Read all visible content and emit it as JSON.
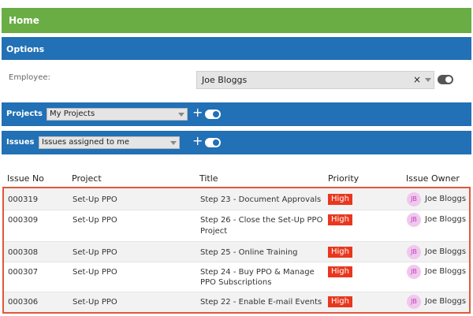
{
  "home": {
    "title": "Home"
  },
  "options": {
    "title": "Options",
    "employee_label": "Employee:",
    "employee_value": "Joe Bloggs",
    "clear_glyph": "×"
  },
  "projects": {
    "label": "Projects",
    "selected": "My Projects",
    "plus": "+"
  },
  "issues": {
    "label": "Issues",
    "selected": "Issues assigned to me",
    "plus": "+"
  },
  "table": {
    "columns": [
      "Issue No",
      "Project",
      "Title",
      "Priority",
      "Issue Owner"
    ],
    "rows": [
      {
        "issue_no": "000319",
        "project": "Set-Up PPO",
        "title_lines": [
          "Step 23 - Document Approvals"
        ],
        "priority": "High",
        "initials": "JB",
        "owner": "Joe Bloggs"
      },
      {
        "issue_no": "000309",
        "project": "Set-Up PPO",
        "title_lines": [
          "Step 26 - Close the Set-Up PPO",
          "Project"
        ],
        "priority": "High",
        "initials": "JB",
        "owner": "Joe Bloggs"
      },
      {
        "issue_no": "000308",
        "project": "Set-Up PPO",
        "title_lines": [
          "Step 25 - Online Training"
        ],
        "priority": "High",
        "initials": "JB",
        "owner": "Joe Bloggs"
      },
      {
        "issue_no": "000307",
        "project": "Set-Up PPO",
        "title_lines": [
          "Step 24 - Buy PPO & Manage",
          "PPO Subscriptions"
        ],
        "priority": "High",
        "initials": "JB",
        "owner": "Joe Bloggs"
      },
      {
        "issue_no": "000306",
        "project": "Set-Up PPO",
        "title_lines": [
          "Step 22 - Enable E-mail Events"
        ],
        "priority": "High",
        "initials": "JB",
        "owner": "Joe Bloggs"
      }
    ]
  },
  "colors": {
    "home_bar": "#6aad45",
    "section_bar": "#2270b5",
    "priority_high": "#e8371e",
    "table_highlight": "#e0583a",
    "avatar_bg": "#f0c8ee"
  },
  "icons": {
    "clear": "close-icon",
    "dropdown": "chevron-down-icon",
    "add": "plus-icon",
    "toggle": "toggle-switch-icon"
  }
}
